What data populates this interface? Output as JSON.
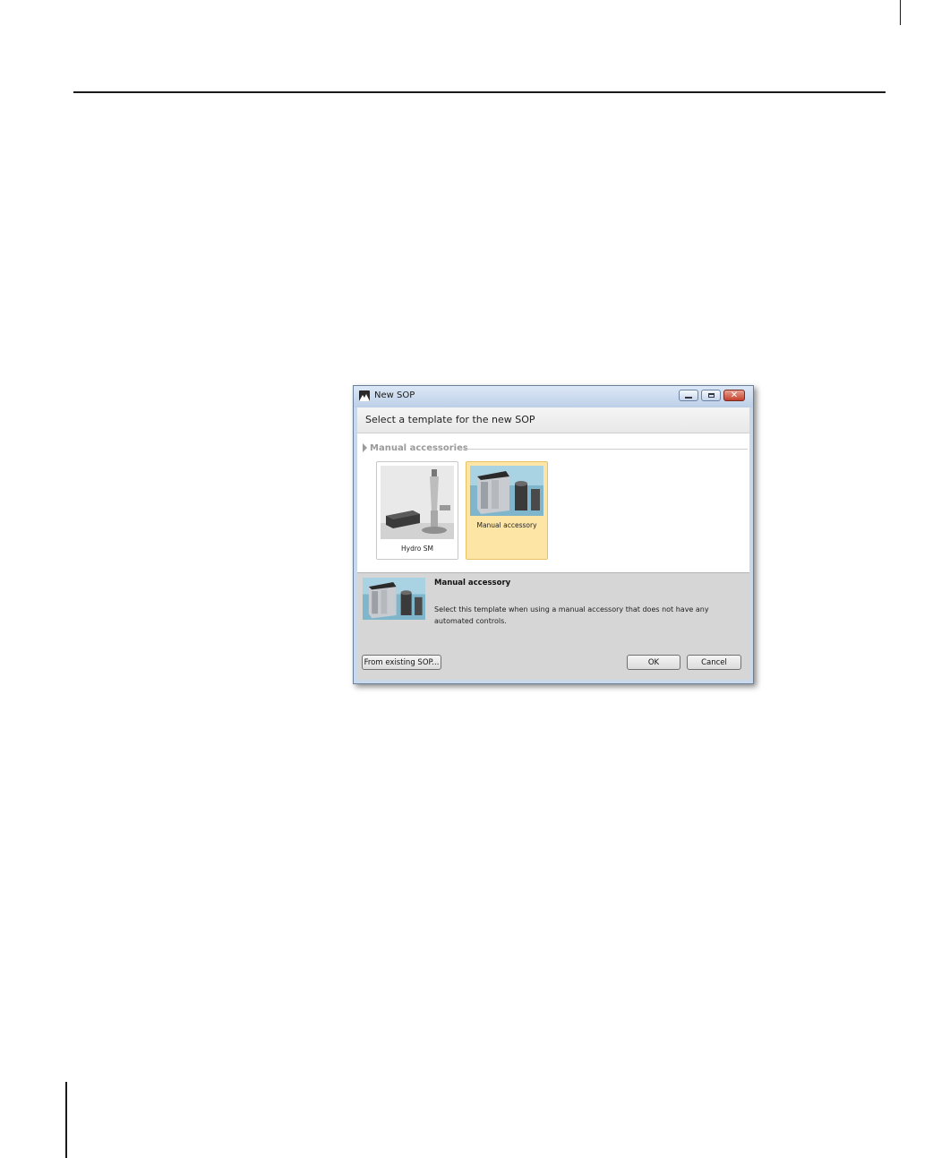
{
  "window": {
    "title": "New SOP",
    "icon": "mountain-app-icon",
    "controls": {
      "minimize": "minimize-icon",
      "maximize": "maximize-icon",
      "close": "close-icon"
    }
  },
  "header": {
    "instruction": "Select a template for the new SOP"
  },
  "group": {
    "label": "Manual accessories",
    "items": [
      {
        "label": "Hydro SM",
        "selected": false
      },
      {
        "label": "Manual accessory",
        "selected": true
      }
    ]
  },
  "description": {
    "title": "Manual accessory",
    "body": "Select this template when using a manual accessory that does not have any automated controls."
  },
  "buttons": {
    "from_existing": "From existing SOP...",
    "ok": "OK",
    "cancel": "Cancel"
  },
  "colors": {
    "selection": "#fde5a6",
    "frame": "#c9d8ea",
    "close": "#c3412b"
  }
}
